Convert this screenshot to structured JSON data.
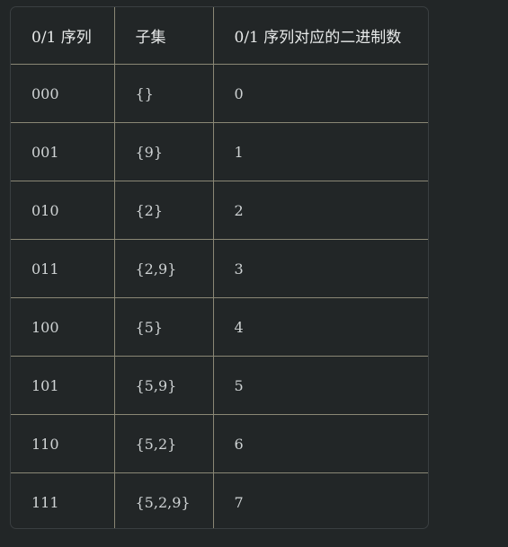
{
  "table": {
    "headers": [
      "0/1 序列",
      "子集",
      "0/1 序列对应的二进制数"
    ],
    "rows": [
      [
        "000",
        "{}",
        "0"
      ],
      [
        "001",
        "{9}",
        "1"
      ],
      [
        "010",
        "{2}",
        "2"
      ],
      [
        "011",
        "{2,9}",
        "3"
      ],
      [
        "100",
        "{5}",
        "4"
      ],
      [
        "101",
        "{5,9}",
        "5"
      ],
      [
        "110",
        "{5,2}",
        "6"
      ],
      [
        "111",
        "{5,2,9}",
        "7"
      ]
    ]
  }
}
